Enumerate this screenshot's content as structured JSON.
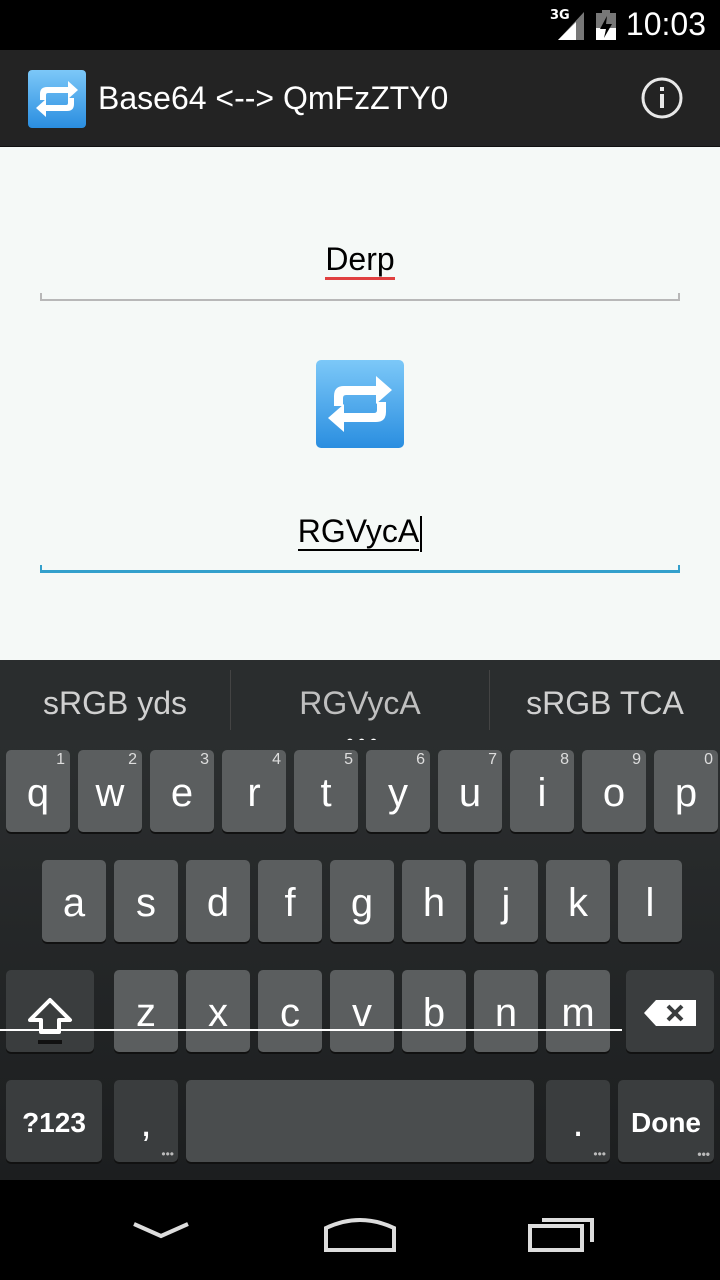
{
  "status": {
    "network": "3G",
    "time": "10:03"
  },
  "actionbar": {
    "title": "Base64 <--> QmFzZTY0",
    "info_icon": "info-icon"
  },
  "fields": {
    "plain": {
      "value": "Derp"
    },
    "encoded": {
      "value": "RGVycA"
    }
  },
  "suggestions": [
    "sRGB yds",
    "RGVycA",
    "sRGB TCA"
  ],
  "keyboard": {
    "row1": [
      {
        "label": "q",
        "hint": "1"
      },
      {
        "label": "w",
        "hint": "2"
      },
      {
        "label": "e",
        "hint": "3"
      },
      {
        "label": "r",
        "hint": "4"
      },
      {
        "label": "t",
        "hint": "5"
      },
      {
        "label": "y",
        "hint": "6"
      },
      {
        "label": "u",
        "hint": "7"
      },
      {
        "label": "i",
        "hint": "8"
      },
      {
        "label": "o",
        "hint": "9"
      },
      {
        "label": "p",
        "hint": "0"
      }
    ],
    "row2": [
      "a",
      "s",
      "d",
      "f",
      "g",
      "h",
      "j",
      "k",
      "l"
    ],
    "row3": [
      "z",
      "x",
      "c",
      "v",
      "b",
      "n",
      "m"
    ],
    "symbols_label": "?123",
    "comma_label": ",",
    "period_label": ".",
    "done_label": "Done"
  },
  "colors": {
    "accent_blue": "#33a0cc",
    "spell_red": "#e04040",
    "icon_blue": "#3aa0e8"
  }
}
